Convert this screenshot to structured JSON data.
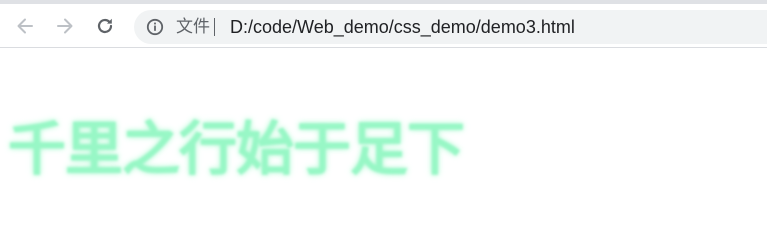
{
  "browser": {
    "address_bar": {
      "scheme_label": "文件",
      "url": "D:/code/Web_demo/css_demo/demo3.html"
    },
    "icons": {
      "back": "arrow-left-icon",
      "forward": "arrow-right-icon",
      "reload": "reload-icon",
      "site_info": "info-icon"
    },
    "colors": {
      "omnibox_background": "#f1f3f4",
      "nav_enabled": "#5f6368",
      "nav_disabled": "#bdc1c6"
    }
  },
  "page": {
    "heading": "千里之行始于足下",
    "heading_color": "#98f7c6"
  }
}
